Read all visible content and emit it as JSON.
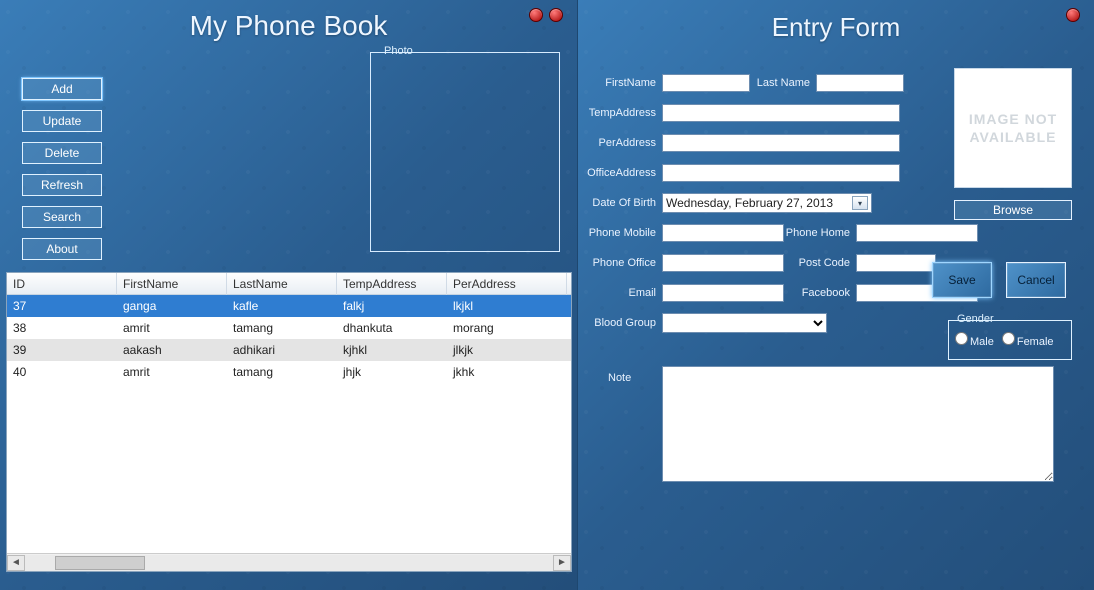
{
  "left": {
    "title": "My Phone Book",
    "buttons": {
      "add": "Add",
      "update": "Update",
      "delete": "Delete",
      "refresh": "Refresh",
      "search": "Search",
      "about": "About"
    },
    "photo_legend": "Photo",
    "grid": {
      "headers": [
        "ID",
        "FirstName",
        "LastName",
        "TempAddress",
        "PerAddress"
      ],
      "rows": [
        {
          "id": "37",
          "first": "ganga",
          "last": "kafle",
          "temp": "falkj",
          "per": "lkjkl",
          "selected": true
        },
        {
          "id": "38",
          "first": "amrit",
          "last": "tamang",
          "temp": "dhankuta",
          "per": "morang",
          "selected": false
        },
        {
          "id": "39",
          "first": "aakash",
          "last": "adhikari",
          "temp": "kjhkl",
          "per": "jlkjk",
          "selected": false,
          "alt": true
        },
        {
          "id": "40",
          "first": "amrit",
          "last": "tamang",
          "temp": "jhjk",
          "per": "jkhk",
          "selected": false
        }
      ]
    }
  },
  "right": {
    "title": "Entry Form",
    "labels": {
      "first": "FirstName",
      "last": "Last Name",
      "temp": "TempAddress",
      "per": "PerAddress",
      "office": "OfficeAddress",
      "dob": "Date Of Birth",
      "mobile": "Phone Mobile",
      "home": "Phone Home",
      "officep": "Phone Office",
      "post": "Post Code",
      "email": "Email",
      "fb": "Facebook",
      "blood": "Blood Group",
      "gender": "Gender",
      "male": "Male",
      "female": "Female",
      "note": "Note",
      "browse": "Browse",
      "save": "Save",
      "cancel": "Cancel",
      "img_placeholder": "IMAGE NOT AVAILABLE"
    },
    "values": {
      "first": "",
      "last": "",
      "temp": "",
      "per": "",
      "office": "",
      "dob": "Wednesday,  February  27, 2013",
      "mobile": "",
      "home": "",
      "officep": "",
      "post": "",
      "email": "",
      "fb": "",
      "blood": "",
      "note": ""
    }
  }
}
